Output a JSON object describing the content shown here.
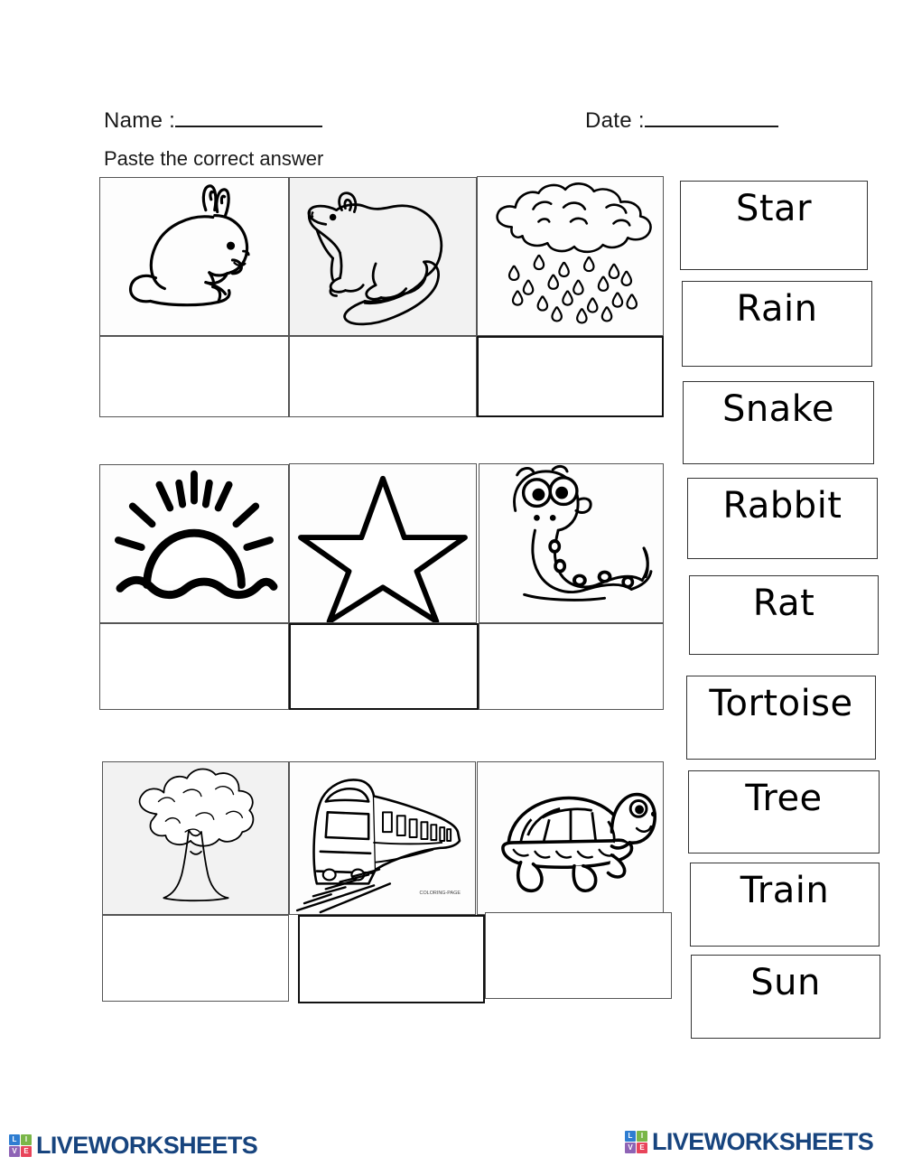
{
  "header": {
    "name_label": "Name :",
    "date_label": "Date :",
    "instruction": "Paste the correct answer"
  },
  "picture_grid": {
    "rows": [
      {
        "row_index": 1,
        "cells": [
          {
            "icon": "rabbit-icon",
            "answer_placeholder": ""
          },
          {
            "icon": "rat-icon",
            "answer_placeholder": ""
          },
          {
            "icon": "rain-cloud-icon",
            "answer_placeholder": ""
          }
        ]
      },
      {
        "row_index": 2,
        "cells": [
          {
            "icon": "sun-icon",
            "answer_placeholder": ""
          },
          {
            "icon": "star-icon",
            "answer_placeholder": ""
          },
          {
            "icon": "snake-icon",
            "answer_placeholder": ""
          }
        ]
      },
      {
        "row_index": 3,
        "cells": [
          {
            "icon": "tree-icon",
            "answer_placeholder": ""
          },
          {
            "icon": "train-icon",
            "answer_placeholder": ""
          },
          {
            "icon": "tortoise-icon",
            "answer_placeholder": ""
          }
        ]
      }
    ]
  },
  "word_bank": {
    "cards": [
      {
        "label": "Star"
      },
      {
        "label": "Rain"
      },
      {
        "label": "Snake"
      },
      {
        "label": "Rabbit"
      },
      {
        "label": "Rat"
      },
      {
        "label": "Tortoise"
      },
      {
        "label": "Tree"
      },
      {
        "label": "Train"
      },
      {
        "label": "Sun"
      }
    ]
  },
  "footer": {
    "left_logo": {
      "wordmark": "LIVEWORKSHEETS",
      "blocks": [
        "L",
        "I",
        "V",
        "E"
      ],
      "block_colors": [
        "#2e7dd1",
        "#7ab648",
        "#8e63b5",
        "#e8445a"
      ],
      "wordmark_color": "#17447e"
    },
    "right_logo": {
      "wordmark": "LIVEWORKSHEETS",
      "blocks": [
        "L",
        "I",
        "V",
        "E"
      ],
      "block_colors": [
        "#2e7dd1",
        "#7ab648",
        "#8e63b5",
        "#e8445a"
      ],
      "wordmark_color": "#17447e"
    }
  }
}
